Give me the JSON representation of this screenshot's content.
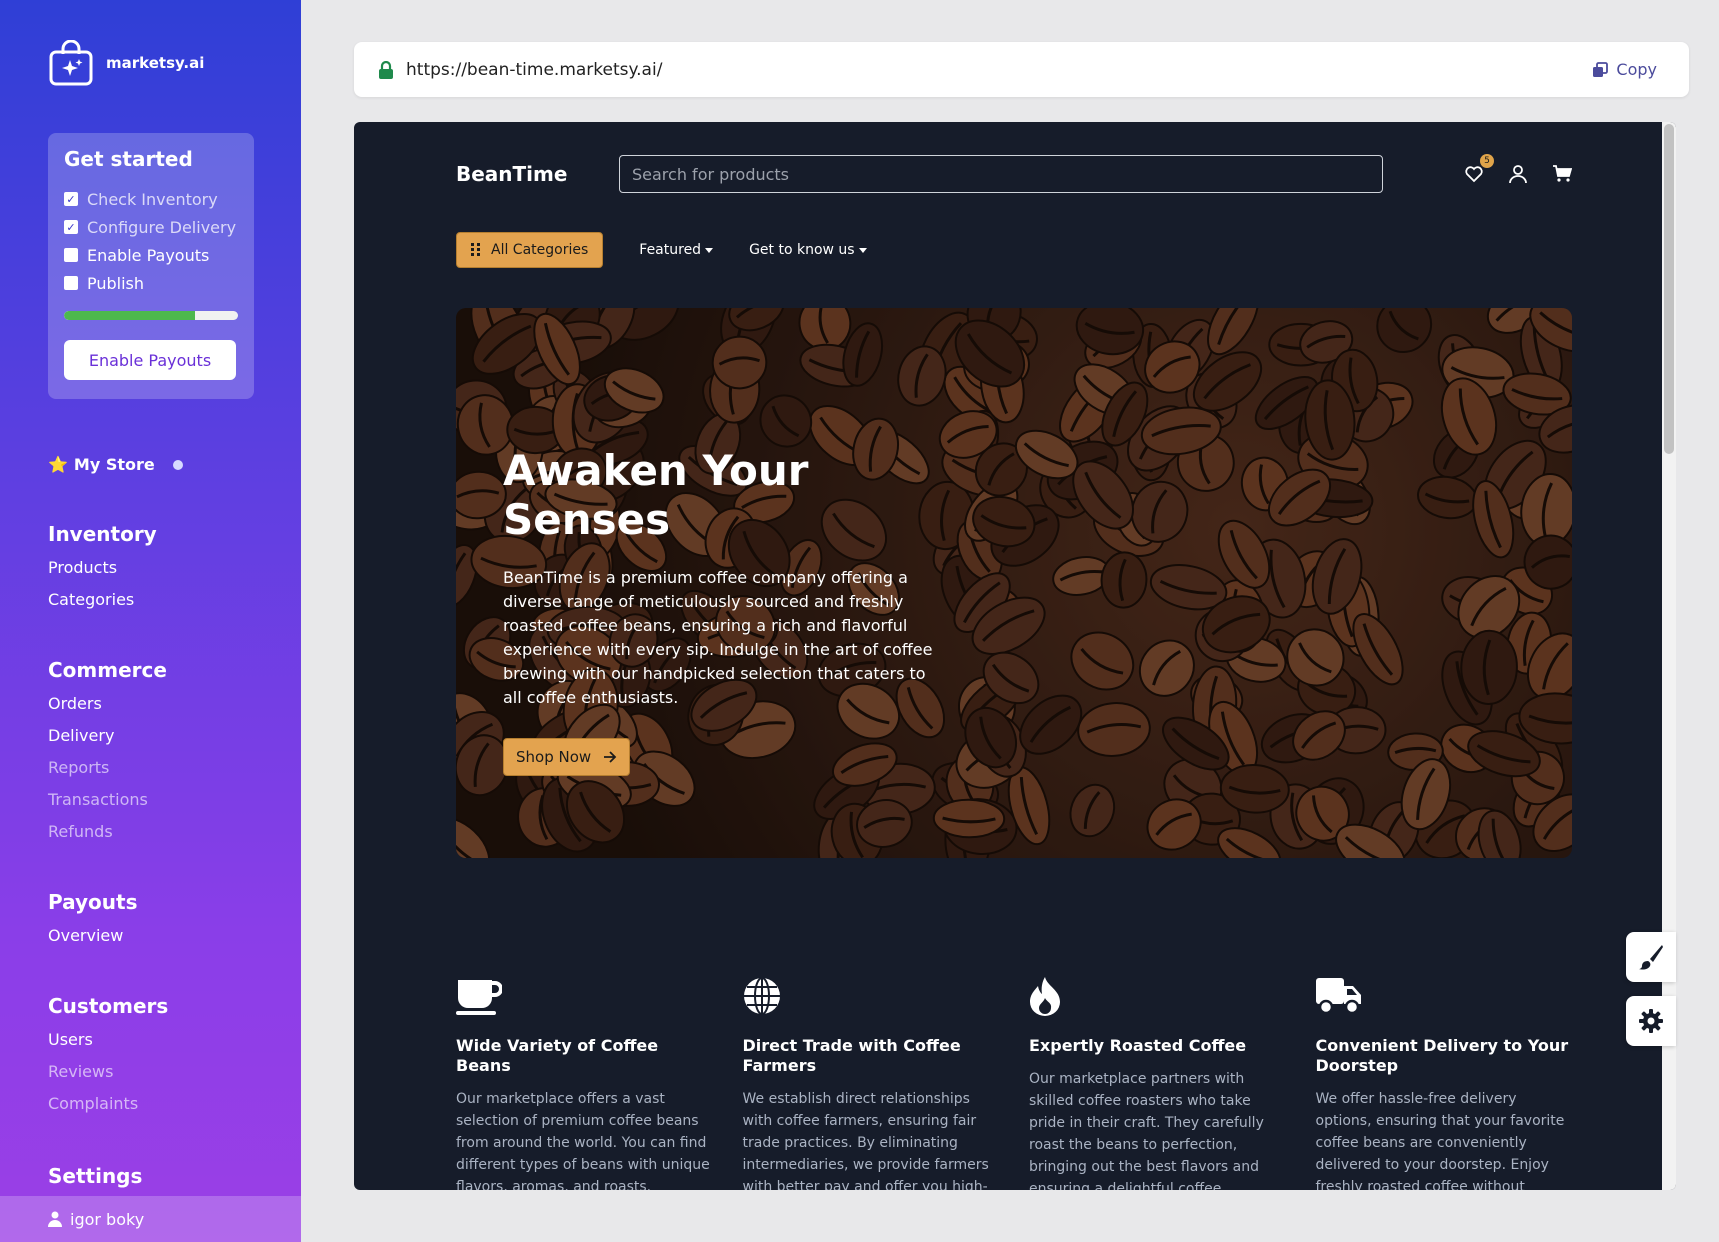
{
  "brand": {
    "name": "marketsy.ai"
  },
  "get_started": {
    "title": "Get started",
    "items": [
      {
        "label": "Check Inventory",
        "checked": true
      },
      {
        "label": "Configure Delivery",
        "checked": true
      },
      {
        "label": "Enable Payouts",
        "checked": false
      },
      {
        "label": "Publish",
        "checked": false
      }
    ],
    "progress_percent": 75,
    "cta_label": "Enable Payouts"
  },
  "my_store": {
    "label": "My Store"
  },
  "nav": {
    "inventory": {
      "title": "Inventory",
      "items": [
        "Products",
        "Categories"
      ]
    },
    "commerce": {
      "title": "Commerce",
      "items": [
        "Orders",
        "Delivery",
        "Reports",
        "Transactions",
        "Refunds"
      ]
    },
    "payouts": {
      "title": "Payouts",
      "items": [
        "Overview"
      ]
    },
    "customers": {
      "title": "Customers",
      "items": [
        "Users",
        "Reviews",
        "Complaints"
      ]
    },
    "settings": {
      "title": "Settings"
    }
  },
  "user": {
    "name": "igor boky"
  },
  "url_bar": {
    "url": "https://bean-time.marketsy.ai/",
    "copy_label": "Copy"
  },
  "storefront": {
    "logo": "BeanTime",
    "search_placeholder": "Search for products",
    "wishlist_count": "5",
    "nav": {
      "all_categories": "All Categories",
      "featured": "Featured",
      "get_to_know": "Get to know us"
    },
    "hero": {
      "title": "Awaken Your Senses",
      "text": "BeanTime is a premium coffee company offering a diverse range of meticulously sourced and freshly roasted coffee beans, ensuring a rich and flavorful experience with every sip. Indulge in the art of coffee brewing with our handpicked selection that caters to all coffee enthusiasts.",
      "button": "Shop Now"
    },
    "features": [
      {
        "icon": "coffee-cup-icon",
        "title": "Wide Variety of Coffee Beans",
        "text": "Our marketplace offers a vast selection of premium coffee beans from around the world. You can find different types of beans with unique flavors, aromas, and roasts."
      },
      {
        "icon": "globe-icon",
        "title": "Direct Trade with Coffee Farmers",
        "text": "We establish direct relationships with coffee farmers, ensuring fair trade practices. By eliminating intermediaries, we provide farmers with better pay and offer you high-"
      },
      {
        "icon": "fire-icon",
        "title": "Expertly Roasted Coffee",
        "text": "Our marketplace partners with skilled coffee roasters who take pride in their craft. They carefully roast the beans to perfection, bringing out the best flavors and ensuring a delightful coffee"
      },
      {
        "icon": "truck-icon",
        "title": "Convenient Delivery to Your Doorstep",
        "text": "We offer hassle-free delivery options, ensuring that your favorite coffee beans are conveniently delivered to your doorstep. Enjoy freshly roasted coffee without"
      }
    ]
  },
  "colors": {
    "accent": "#e3a34f",
    "store_bg": "#161c2a",
    "progress": "#4db84d"
  }
}
